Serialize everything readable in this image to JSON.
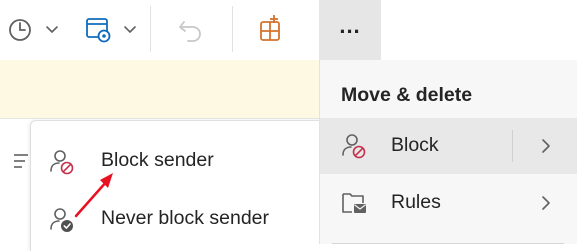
{
  "toolbar": {
    "more_label": "...",
    "buttons": [
      {
        "name": "clock-icon"
      },
      {
        "name": "calendar-settings-icon"
      },
      {
        "name": "undo-icon"
      },
      {
        "name": "apps-add-icon"
      }
    ]
  },
  "main_menu": {
    "header": "Move & delete",
    "items": [
      {
        "label": "Block",
        "icon": "block-person-icon"
      },
      {
        "label": "Rules",
        "icon": "rules-icon"
      }
    ]
  },
  "submenu": {
    "items": [
      {
        "label": "Block sender",
        "icon": "block-person-icon"
      },
      {
        "label": "Never block sender",
        "icon": "safe-person-icon"
      }
    ]
  },
  "colors": {
    "accent_blue": "#0f6cbd",
    "icon_gray": "#616161",
    "undo_disabled": "#c8c8c8",
    "block_red": "#c4314b",
    "apps_orange": "#d4722c",
    "banner": "#fdf9e3",
    "selected_bg": "#e8e8e8",
    "annotation_arrow": "#e81123"
  }
}
